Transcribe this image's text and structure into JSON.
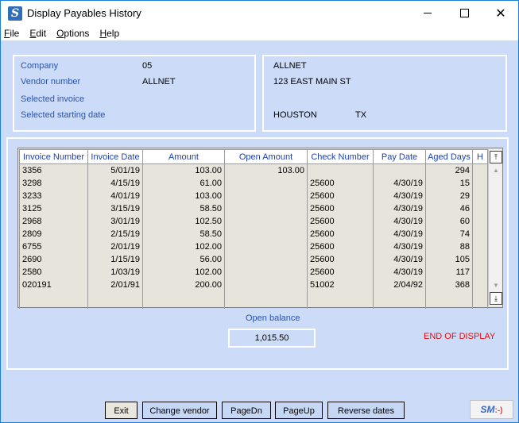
{
  "window": {
    "title": "Display Payables History",
    "app_icon_glyph": "S",
    "controls": {
      "minimize": "minimize-icon",
      "maximize": "maximize-icon",
      "close": "close-icon"
    }
  },
  "menu": {
    "items": [
      {
        "label_u": "F",
        "label_rest": "ile"
      },
      {
        "label_u": "E",
        "label_rest": "dit"
      },
      {
        "label_u": "O",
        "label_rest": "ptions"
      },
      {
        "label_u": "H",
        "label_rest": "elp"
      }
    ]
  },
  "info": {
    "company_label": "Company",
    "company_value": "05",
    "vendor_label": "Vendor number",
    "vendor_value": "ALLNET",
    "invoice_label": "Selected invoice",
    "invoice_value": "",
    "start_date_label": "Selected starting date",
    "start_date_value": ""
  },
  "vendor_address": {
    "name": "ALLNET",
    "street": "123 EAST MAIN ST",
    "city": "HOUSTON",
    "state": "TX"
  },
  "table": {
    "headers": [
      "Invoice Number",
      "Invoice Date",
      "Amount",
      "Open Amount",
      "Check Number",
      "Pay Date",
      "Aged Days",
      "H"
    ],
    "rows": [
      [
        "3356",
        "5/01/19",
        "103.00",
        "103.00",
        "",
        "",
        "294",
        ""
      ],
      [
        "3298",
        "4/15/19",
        "61.00",
        "",
        "25600",
        "4/30/19",
        "15",
        ""
      ],
      [
        "3233",
        "4/01/19",
        "103.00",
        "",
        "25600",
        "4/30/19",
        "29",
        ""
      ],
      [
        "3125",
        "3/15/19",
        "58.50",
        "",
        "25600",
        "4/30/19",
        "46",
        ""
      ],
      [
        "2968",
        "3/01/19",
        "102.50",
        "",
        "25600",
        "4/30/19",
        "60",
        ""
      ],
      [
        "2809",
        "2/15/19",
        "58.50",
        "",
        "25600",
        "4/30/19",
        "74",
        ""
      ],
      [
        "6755",
        "2/01/19",
        "102.00",
        "",
        "25600",
        "4/30/19",
        "88",
        ""
      ],
      [
        "2690",
        "1/15/19",
        "56.00",
        "",
        "25600",
        "4/30/19",
        "105",
        ""
      ],
      [
        "2580",
        "1/03/19",
        "102.00",
        "",
        "25600",
        "4/30/19",
        "117",
        ""
      ],
      [
        "020191",
        "2/01/91",
        "200.00",
        "",
        "51002",
        "2/04/92",
        "368",
        ""
      ]
    ]
  },
  "open_balance": {
    "label": "Open balance",
    "value": "1,015.50"
  },
  "status": "END OF DISPLAY",
  "buttons": {
    "exit": "Exit",
    "change_vendor": "Change vendor",
    "page_dn": "PageDn",
    "page_up": "PageUp",
    "reverse_dates": "Reverse dates"
  },
  "logo": {
    "text": "SM",
    "smile": ":-)"
  },
  "colors": {
    "label_blue": "#2b54a8",
    "header_blue": "#1e3fb0",
    "status_red": "#e01010",
    "background": "#ccdbf7"
  }
}
